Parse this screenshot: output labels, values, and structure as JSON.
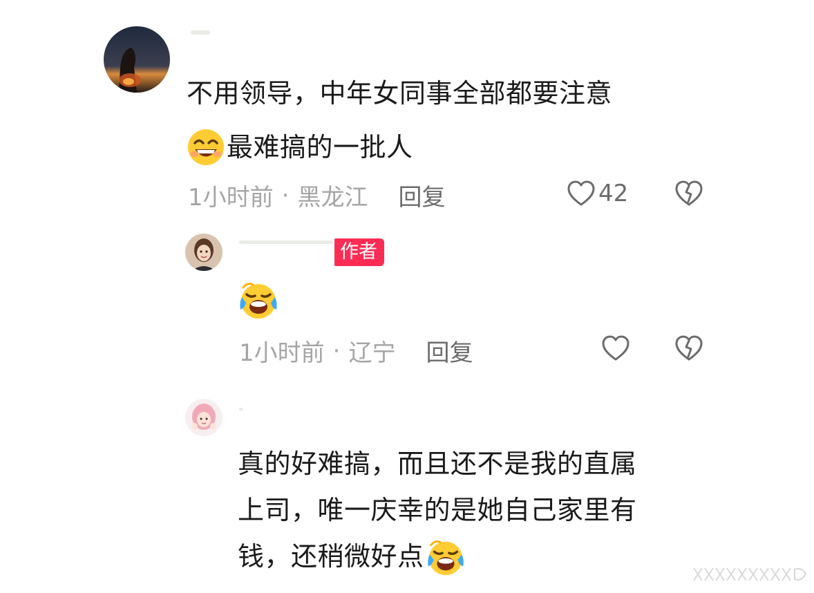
{
  "comments": [
    {
      "text_line1": "不用领导，中年女同事全部都要注意",
      "emoji": "grinning-sweat-emoji",
      "text_line2": "最难搞的一批人",
      "time": "1小时前",
      "separator": "·",
      "location": "黑龙江",
      "reply_label": "回复",
      "likes": "42"
    },
    {
      "author_tag": "作者",
      "emoji": "crying-laughing-emoji",
      "time": "1小时前",
      "separator": "·",
      "location": "辽宁",
      "reply_label": "回复"
    },
    {
      "text_line1": "真的好难搞，而且还不是我的直属",
      "text_line2": "上司，唯一庆幸的是她自己家里有",
      "text_line3": "钱，还稍微好点",
      "emoji": "crying-laughing-emoji"
    }
  ],
  "colors": {
    "author_tag_bg": "#fe2c55",
    "meta_text": "#a5a5a5",
    "reply_text": "#6b6b6b",
    "body_text": "#1a1a1a"
  }
}
